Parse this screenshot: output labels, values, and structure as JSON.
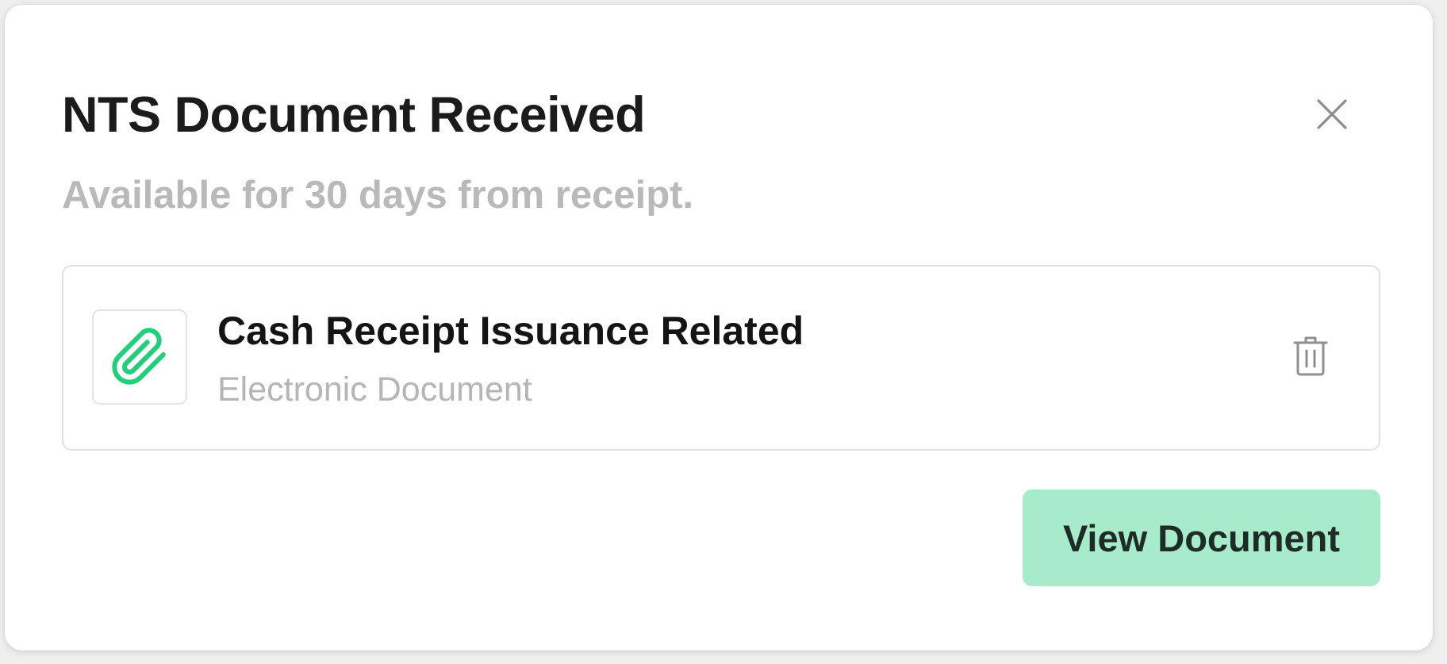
{
  "dialog": {
    "title": "NTS Document Received",
    "subtitle": "Available for 30 days from receipt.",
    "close_icon": "close-icon"
  },
  "document": {
    "icon": "paperclip-icon",
    "name": "Cash Receipt Issuance Related",
    "type": "Electronic Document",
    "delete_icon": "trash-icon"
  },
  "actions": {
    "view_label": "View Document"
  },
  "colors": {
    "accent": "#1fcf7a",
    "button_bg": "#a6ecca",
    "muted_text": "#b9b9b9"
  }
}
